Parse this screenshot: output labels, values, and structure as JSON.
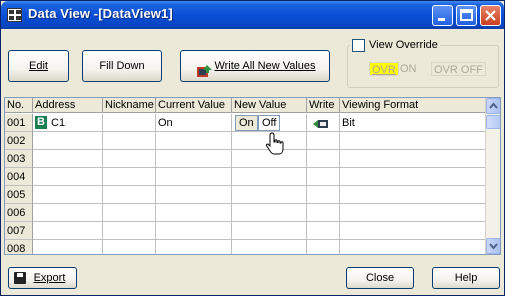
{
  "window": {
    "title": "Data View -[DataView1]",
    "controls": [
      "minimize-icon",
      "maximize-icon",
      "close-icon"
    ]
  },
  "toolbar": {
    "edit_label": "Edit",
    "fill_down_label": "Fill Down",
    "write_all_label": "Write All New Values"
  },
  "view_override": {
    "label": "View Override",
    "checked": false,
    "ovr_label": "OVR",
    "on_label": "ON",
    "off_label": "OVR OFF"
  },
  "grid": {
    "columns": [
      "No.",
      "Address",
      "Nickname",
      "Current Value",
      "New Value",
      "Write",
      "Viewing Format"
    ],
    "rows": [
      {
        "no": "001",
        "address": "C1",
        "nickname": "",
        "current": "On",
        "new_on": "On",
        "new_off": "Off",
        "format": "Bit"
      },
      {
        "no": "002"
      },
      {
        "no": "003"
      },
      {
        "no": "004"
      },
      {
        "no": "005"
      },
      {
        "no": "006"
      },
      {
        "no": "007"
      },
      {
        "no": "008"
      }
    ],
    "address_type_badge": "B"
  },
  "footer": {
    "export_label": "Export",
    "close_label": "Close",
    "help_label": "Help"
  },
  "colors": {
    "titlebar": "#0a4fd6",
    "window_bg": "#ece9d8",
    "ovr_highlight": "#ffff00",
    "badge": "#1a7e50"
  }
}
